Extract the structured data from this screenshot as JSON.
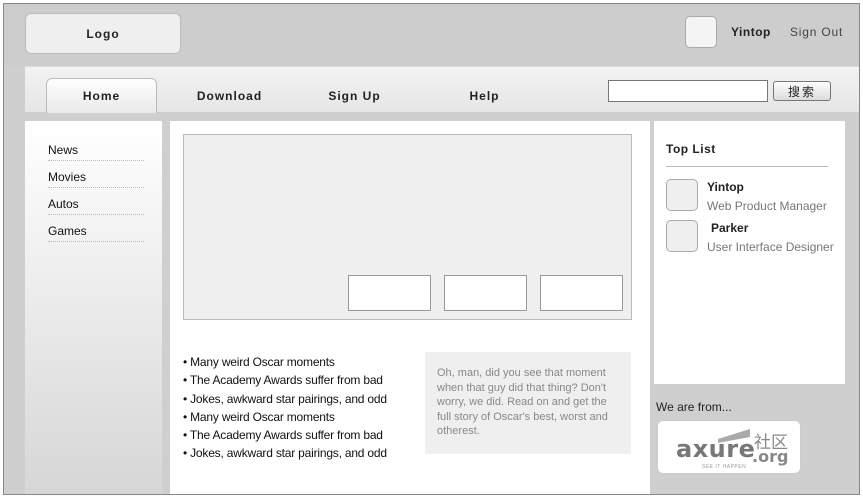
{
  "header": {
    "logo_label": "Logo",
    "username": "Yintop",
    "signout_label": "Sign Out"
  },
  "nav": {
    "tabs": [
      {
        "label": "Home",
        "active": true
      },
      {
        "label": "Download",
        "active": false
      },
      {
        "label": "Sign Up",
        "active": false
      },
      {
        "label": "Help",
        "active": false
      }
    ],
    "search": {
      "value": "",
      "placeholder": "",
      "button_label": "搜索"
    }
  },
  "sidebar": {
    "items": [
      {
        "label": "News"
      },
      {
        "label": "Movies"
      },
      {
        "label": "Autos"
      },
      {
        "label": "Games"
      }
    ]
  },
  "main": {
    "news": [
      "• Many weird Oscar moments",
      "• The Academy Awards suffer from bad",
      "• Jokes, awkward star pairings, and odd",
      "• Many weird Oscar moments",
      "• The Academy Awards suffer from bad",
      "• Jokes, awkward star pairings, and odd"
    ],
    "quote": "Oh, man, did you see that moment when that guy did that thing? Don't worry, we did. Read on and get the full story of Oscar's best, worst and otherest."
  },
  "toplist": {
    "title": "Top List",
    "people": [
      {
        "name": "Yintop",
        "role": "Web Product Manager"
      },
      {
        "name": "Parker",
        "role": "User Interface Designer"
      }
    ]
  },
  "footer": {
    "we_are_from": "We are from...",
    "badge": {
      "brand": "axure",
      "cn": "社区",
      "domain": ".org",
      "sub": "SEE IT HAPPEN"
    }
  },
  "colors": {
    "background": "#cfcfcf",
    "panel": "#ffffff",
    "placeholder": "#efefef"
  }
}
